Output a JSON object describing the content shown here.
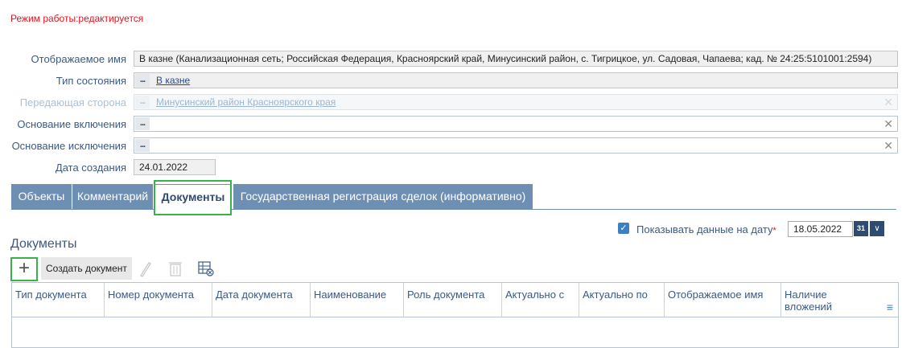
{
  "mode_text": "Режим работы:редактируется",
  "form": {
    "display_name_label": "Отображаемое имя",
    "display_name_value": "В казне (Канализационная сеть; Российская Федерация, Красноярский край, Минусинский район, с. Тигрицкое, ул. Садовая, Чапаева; кад. № 24:25:5101001:2594)",
    "state_type_label": "Тип состояния",
    "state_type_value": "В казне",
    "transferring_party_label": "Передающая сторона",
    "transferring_party_value": "Минусинский район Красноярского края",
    "inclusion_basis_label": "Основание включения",
    "inclusion_basis_value": "",
    "exclusion_basis_label": "Основание исключения",
    "exclusion_basis_value": "",
    "creation_date_label": "Дата создания",
    "creation_date_value": "24.01.2022",
    "dots_label": "...",
    "clear_symbol": "✕"
  },
  "tabs": [
    {
      "label": "Объекты"
    },
    {
      "label": "Комментарий"
    },
    {
      "label": "Документы"
    },
    {
      "label": "Государственная регистрация сделок (информативно)"
    }
  ],
  "active_tab": "Документы",
  "show_data": {
    "label": "Показывать данные на дату",
    "required_mark": "*",
    "checked": true,
    "date": "18.05.2022",
    "calendar_text": "31",
    "chevron": "∨"
  },
  "section_title": "Документы",
  "toolbar": {
    "add_symbol": "+",
    "create_label": "Создать документ",
    "edit_icon": "pencil-icon",
    "delete_icon": "trash-icon",
    "settings_icon": "grid-settings-icon"
  },
  "grid": {
    "columns": [
      "Тип документа",
      "Номер документа",
      "Дата документа",
      "Наименование",
      "Роль документа",
      "Актуально с",
      "Актуально по",
      "Отображаемое имя",
      "Наличие вложений"
    ],
    "menu_symbol": "≡"
  },
  "colors": {
    "accent": "#6e8fb4",
    "highlight": "#38b24a",
    "mode_text": "#e0141e"
  }
}
